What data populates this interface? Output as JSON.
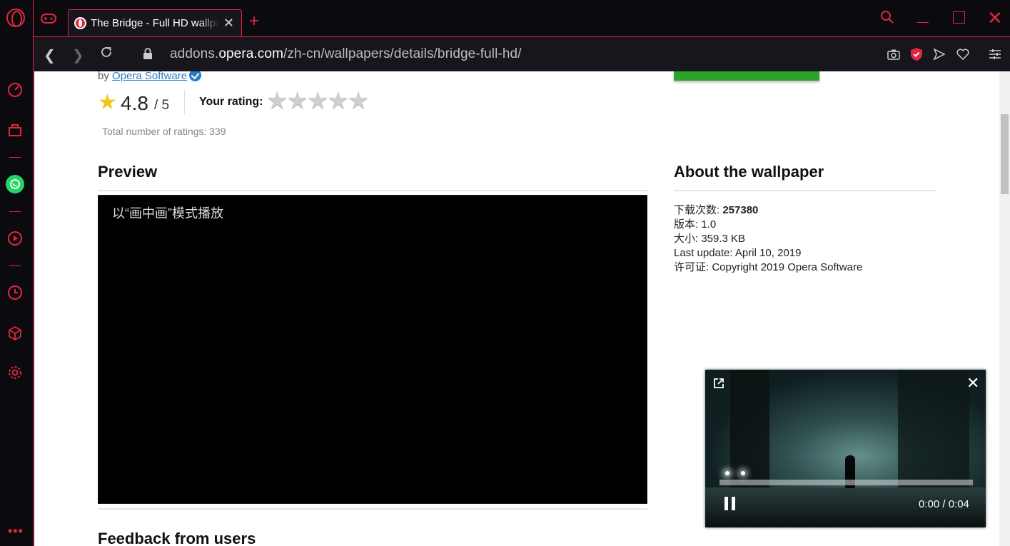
{
  "browser": {
    "tab": {
      "title": "The Bridge - Full HD wallpaper"
    },
    "address": {
      "prefix": "addons.",
      "host": "opera.com",
      "path": "/zh-cn/wallpapers/details/bridge-full-hd/"
    }
  },
  "page": {
    "byline_prefix": "by",
    "author": "Opera Software",
    "rating_value": "4.8",
    "rating_max": "/ 5",
    "your_rating_label": "Your rating:",
    "total_ratings": "Total number of ratings: 339",
    "preview_heading": "Preview",
    "pip_placeholder": "以“画中画”模式播放",
    "feedback_heading": "Feedback from users",
    "about_heading": "About the wallpaper",
    "info": {
      "downloads_label": "下载次数: ",
      "downloads_value": "257380",
      "version": "版本: 1.0",
      "size": "大小: 359.3 KB",
      "last_update": "Last update: April 10, 2019",
      "license": "许可证: Copyright 2019 Opera Software"
    }
  },
  "pip_player": {
    "time": "0:00 / 0:04"
  },
  "colors": {
    "accent": "#e0263f",
    "link": "#2a7ac6",
    "star": "#f5c518",
    "install_button": "#2aa52a"
  }
}
